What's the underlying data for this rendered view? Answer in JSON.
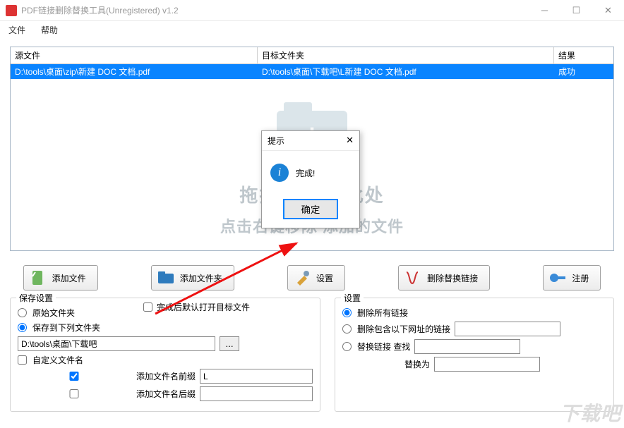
{
  "window": {
    "title": "PDF链接删除替换工具(Unregistered) v1.2"
  },
  "menu": {
    "file": "文件",
    "help": "帮助"
  },
  "table": {
    "headers": {
      "src": "源文件",
      "dest": "目标文件夹",
      "result": "结果"
    },
    "rows": [
      {
        "src": "D:\\tools\\桌面\\zip\\新建 DOC 文档.pdf",
        "dest": "D:\\tools\\桌面\\下载吧\\L新建 DOC 文档.pdf",
        "result": "成功"
      }
    ]
  },
  "dropzone": {
    "line1": "拖拽文件              至此处",
    "line2": "点击右键移除            添加的文件"
  },
  "buttons": {
    "add_file": "添加文件",
    "add_folder": "添加文件夹",
    "settings": "设置",
    "run": "删除替换链接",
    "register": "注册"
  },
  "save": {
    "legend": "保存设置",
    "original": "原始文件夹",
    "saveto": "保存到下列文件夹",
    "path": "D:\\tools\\桌面\\下载吧",
    "browse": "...",
    "customname": "自定义文件名",
    "prefix": "添加文件名前缀",
    "prefix_val": "L",
    "suffix": "添加文件名后缀",
    "autoopen": "完成后默认打开目标文件"
  },
  "options": {
    "legend": "设置",
    "del_all": "删除所有链接",
    "del_contain": "删除包含以下网址的链接",
    "replace": "替换链接  查找",
    "replacewith": "替换为"
  },
  "dialog": {
    "title": "提示",
    "msg": "完成!",
    "ok": "确定"
  },
  "watermark": "下载吧"
}
